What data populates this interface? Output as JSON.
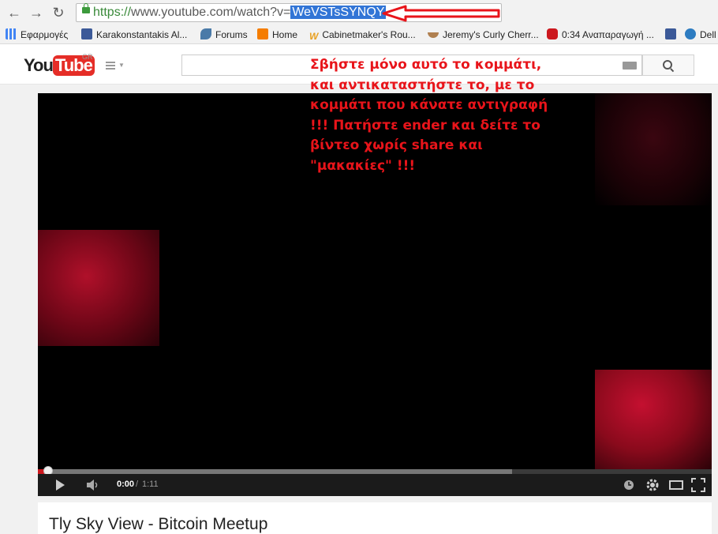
{
  "browser": {
    "url": {
      "scheme": "https://",
      "host_path": "www.youtube.com/watch?v=",
      "video_id": "WeVSTsSYNQY"
    },
    "bookmarks": [
      {
        "label": "Εφαρμογές",
        "icon": "apps-grid-icon",
        "color": "#4285f4"
      },
      {
        "label": "Karakonstantakis Al...",
        "icon": "facebook-icon",
        "color": "#3b5998"
      },
      {
        "label": "Forums",
        "icon": "bird-icon",
        "color": "#4a7aa8"
      },
      {
        "label": "Home",
        "icon": "blogger-icon",
        "color": "#f57d00"
      },
      {
        "label": "Cabinetmaker's Rou...",
        "icon": "w-logo-icon",
        "color": "#e8a020"
      },
      {
        "label": "Jeremy's Curly Cherr...",
        "icon": "bowl-icon",
        "color": "#b08050"
      },
      {
        "label": "0:34 Αναπαραγωγή ...",
        "icon": "youtube-icon",
        "color": "#cc181e"
      },
      {
        "label": "",
        "icon": "facebook-icon",
        "color": "#3b5998"
      },
      {
        "label": "Dell",
        "icon": "dell-icon",
        "color": "#2d7cc1"
      }
    ]
  },
  "youtube": {
    "logo_you": "You",
    "logo_tube": "Tube",
    "region": "GR",
    "search_placeholder": ""
  },
  "annotation": {
    "text": "Σβήστε μόνο αυτό το κομμάτι, και αντικαταστήστε το, με το κομμάτι που κάνατε αντιγραφή !!! Πατήστε ender και δείτε το βίντεο χωρίς share και \"μακακίες\" !!!",
    "color": "#e8141a"
  },
  "player": {
    "time_current": "0:00",
    "time_separator": "/",
    "time_total": "1:11",
    "played_fraction": 0.0,
    "buffered_fraction": 0.7
  },
  "video": {
    "title": "Tly Sky View - Bitcoin Meetup"
  }
}
